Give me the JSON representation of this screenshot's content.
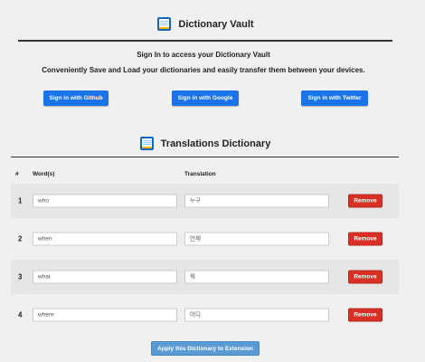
{
  "vault": {
    "title": "Dictionary Vault",
    "signin_title": "Sign In to access your Dictionary Vault",
    "description": "Conveniently Save and Load your dictionaries and easily transfer them between your devices.",
    "buttons": {
      "github": "Sign in with Github",
      "google": "Sign in with Google",
      "twitter": "Sign in with Twitter"
    }
  },
  "dictionary": {
    "title": "Translations Dictionary",
    "columns": {
      "num": "#",
      "word": "Word(s)",
      "translation": "Translation"
    },
    "rows": [
      {
        "num": "1",
        "word": "who",
        "translation": "누구",
        "remove_label": "Remove"
      },
      {
        "num": "2",
        "word": "when",
        "translation": "언제",
        "remove_label": "Remove"
      },
      {
        "num": "3",
        "word": "what",
        "translation": "뭐",
        "remove_label": "Remove"
      },
      {
        "num": "4",
        "word": "where",
        "translation": "어디",
        "remove_label": "Remove"
      }
    ],
    "apply_label": "Apply this Dictionary to Extension"
  },
  "icons": {
    "title_icon": "book-icon"
  },
  "colors": {
    "primary_blue": "#1a73e8",
    "remove_red": "#d93025",
    "apply_blue": "#5b9bd5"
  }
}
